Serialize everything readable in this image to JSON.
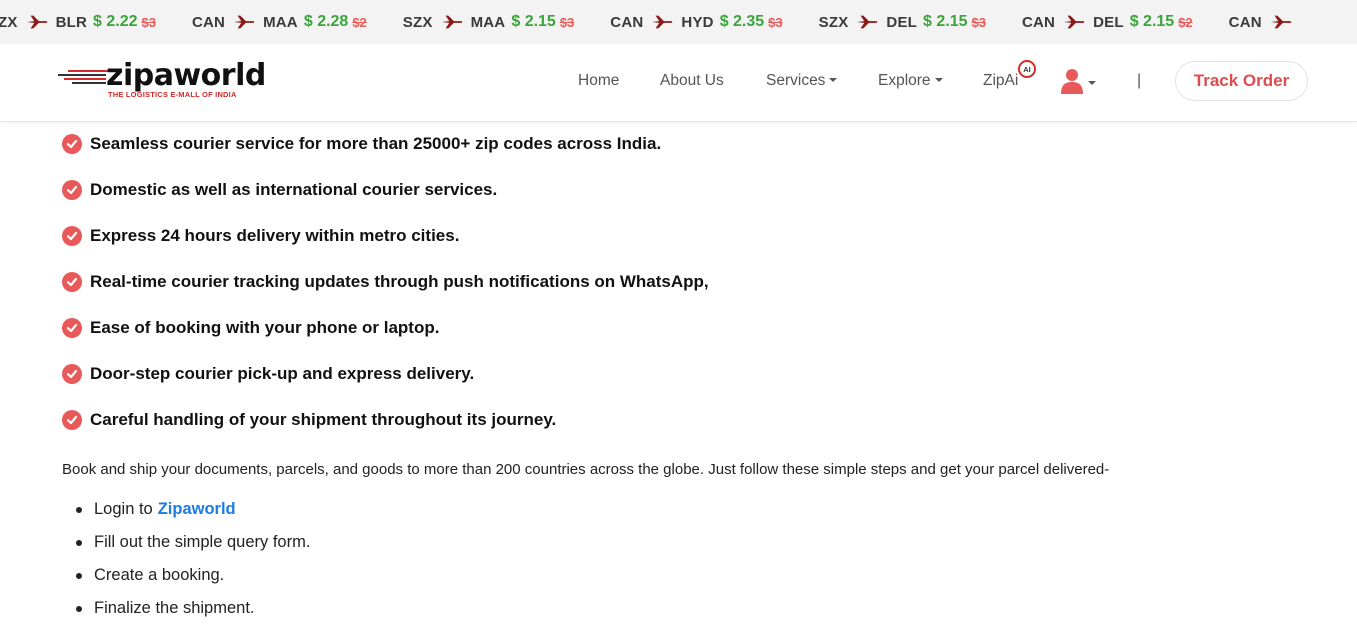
{
  "ticker": {
    "items": [
      {
        "from": "ZX",
        "to": "BLR",
        "price": "$ 2.22",
        "old": "$3"
      },
      {
        "from": "CAN",
        "to": "MAA",
        "price": "$ 2.28",
        "old": "$2"
      },
      {
        "from": "SZX",
        "to": "MAA",
        "price": "$ 2.15",
        "old": "$3"
      },
      {
        "from": "CAN",
        "to": "HYD",
        "price": "$ 2.35",
        "old": "$3"
      },
      {
        "from": "SZX",
        "to": "DEL",
        "price": "$ 2.15",
        "old": "$3"
      },
      {
        "from": "CAN",
        "to": "DEL",
        "price": "$ 2.15",
        "old": "$2"
      },
      {
        "from": "CAN",
        "to": "",
        "price": "",
        "old": ""
      }
    ]
  },
  "header": {
    "logo_text": "zipaworld",
    "logo_tagline": "THE LOGISTICS E-MALL OF INDIA",
    "nav": {
      "home": "Home",
      "about": "About Us",
      "services": "Services",
      "explore": "Explore",
      "zipai": "ZipAi",
      "ai_badge": "AI",
      "separator": "|"
    },
    "track_order": "Track Order"
  },
  "features": [
    "Seamless courier service for more than 25000+ zip codes across India.",
    "Domestic as well as international courier services.",
    "Express 24 hours delivery within metro cities.",
    "Real-time courier tracking updates through push notifications on WhatsApp,",
    "Ease of booking with your phone or laptop.",
    "Door-step courier pick-up and express delivery.",
    "Careful handling of your shipment throughout its journey."
  ],
  "intro": "Book and ship your documents, parcels, and goods to more than 200 countries across the globe. Just follow these simple steps and get your parcel delivered-",
  "steps": {
    "login_prefix": "Login to",
    "login_link": "Zipaworld",
    "fill_form": "Fill out the simple query form.",
    "create_booking": "Create a booking.",
    "finalize": "Finalize the shipment."
  },
  "colors": {
    "accent": "#e85a5a",
    "price_green": "#3aa53a",
    "link_blue": "#1e7be0",
    "plane": "#8b1a1a"
  }
}
